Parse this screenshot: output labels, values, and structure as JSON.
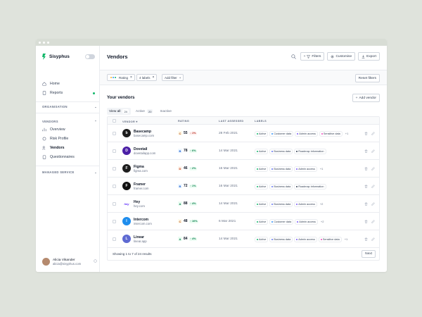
{
  "app": {
    "name": "Sisyphus"
  },
  "sidebar": {
    "items": [
      {
        "label": "Home"
      },
      {
        "label": "Reports"
      }
    ],
    "sections": [
      {
        "label": "ORGANISATION"
      },
      {
        "label": "VENDORS"
      },
      {
        "label": "MANAGED SERVICE"
      }
    ],
    "vendor_items": [
      {
        "label": "Overview"
      },
      {
        "label": "Risk Profile"
      },
      {
        "label": "Vendors"
      },
      {
        "label": "Questionnaires"
      }
    ],
    "user": {
      "name": "Alicia Vikander",
      "email": "alicia@sisyphus.com"
    }
  },
  "header": {
    "title": "Vendors",
    "filters_label": "Filters",
    "customise_label": "Customise",
    "export_label": "Export"
  },
  "filterbar": {
    "chips": [
      {
        "label": "Rating"
      },
      {
        "label": "4 labels"
      }
    ],
    "add_filter_label": "Add filter",
    "reset_label": "Reset filters"
  },
  "content": {
    "section_title": "Your vendors",
    "add_vendor_label": "Add vendor",
    "tabs": [
      {
        "label": "View all",
        "count": "24"
      },
      {
        "label": "Active",
        "count": "20"
      },
      {
        "label": "Inactive",
        "count": ""
      }
    ]
  },
  "table": {
    "columns": {
      "vendor": "VENDOR",
      "rating": "RATING",
      "last_assessed": "LAST ASSESSED",
      "labels": "LABELS"
    },
    "rows": [
      {
        "name": "Basecamp",
        "url": "basecamp.com",
        "grade": "C",
        "score": "55",
        "delta": "1%",
        "trend": "down",
        "date": "28 Feb 2021",
        "labels": [
          "Active",
          "Customer data",
          "Admin access",
          "Sensitive data"
        ],
        "more": "+1",
        "logo_color": "#1c1c1c",
        "logo_text": "b"
      },
      {
        "name": "Dovetail",
        "url": "dovetailapp.com",
        "grade": "B",
        "score": "78",
        "delta": "6%",
        "trend": "up",
        "date": "14 Mar 2021",
        "labels": [
          "Active",
          "Business data",
          "Roadmap information"
        ],
        "more": "",
        "logo_color": "#4b1fa6",
        "logo_text": "D"
      },
      {
        "name": "Figma",
        "url": "figma.com",
        "grade": "D",
        "score": "46",
        "delta": "2%",
        "trend": "up",
        "date": "16 Mar 2021",
        "labels": [
          "Active",
          "Business data",
          "Admin access"
        ],
        "more": "+1",
        "logo_color": "#1e1e1e",
        "logo_text": "F"
      },
      {
        "name": "Framer",
        "url": "framer.com",
        "grade": "B",
        "score": "72",
        "delta": "1%",
        "trend": "up",
        "date": "16 Mar 2021",
        "labels": [
          "Active",
          "Business data",
          "Roadmap information"
        ],
        "more": "",
        "logo_color": "#111111",
        "logo_text": "F"
      },
      {
        "name": "Hey",
        "url": "hey.com",
        "grade": "A",
        "score": "88",
        "delta": "4%",
        "trend": "up",
        "date": "14 Mar 2021",
        "labels": [
          "Active",
          "Business data",
          "Admin access"
        ],
        "more": "+2",
        "logo_color": "#ffffff",
        "logo_text": "hey"
      },
      {
        "name": "Intercom",
        "url": "intercom.com",
        "grade": "C",
        "score": "48",
        "delta": "10%",
        "trend": "up",
        "date": "6 Mar 2021",
        "labels": [
          "Active",
          "Customer data",
          "Admin access"
        ],
        "more": "+2",
        "logo_color": "#1f8ded",
        "logo_text": "I"
      },
      {
        "name": "Linear",
        "url": "linear.app",
        "grade": "A",
        "score": "84",
        "delta": "4%",
        "trend": "up",
        "date": "14 Mar 2021",
        "labels": [
          "Active",
          "Business data",
          "Admin access",
          "Sensitive data"
        ],
        "more": "+1",
        "logo_color": "#5e6ad2",
        "logo_text": "L"
      }
    ],
    "footer": {
      "info": "Showing 1 to 7 of 24 results",
      "next_label": "Next"
    }
  },
  "colors": {
    "label_dots": {
      "Active": "#12b76a",
      "Customer data": "#2e90fa",
      "Admin access": "#7a5af8",
      "Sensitive data": "#ee46bc",
      "Business data": "#6172f3",
      "Roadmap information": "#344054"
    },
    "grades": {
      "A": "#ecfdf3",
      "B": "#eff8ff",
      "C": "#fffaeb",
      "D": "#fef6ee"
    }
  }
}
